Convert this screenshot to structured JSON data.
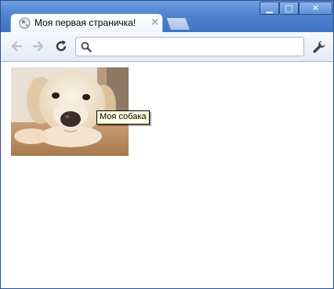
{
  "tab": {
    "title": "Моя первая страничка!",
    "close_glyph": "×"
  },
  "window_controls": {
    "minimize_glyph": "▁",
    "maximize_glyph": "□",
    "close_glyph": "✕"
  },
  "toolbar": {
    "back_icon": "arrow-left-icon",
    "forward_icon": "arrow-right-icon",
    "reload_icon": "reload-icon",
    "address_value": "",
    "address_placeholder": "",
    "menu_icon": "wrench-icon"
  },
  "page": {
    "image_tooltip": "Моя собака"
  },
  "colors": {
    "frame": "#4a7bc4",
    "tooltip_bg": "#ffffe1"
  }
}
